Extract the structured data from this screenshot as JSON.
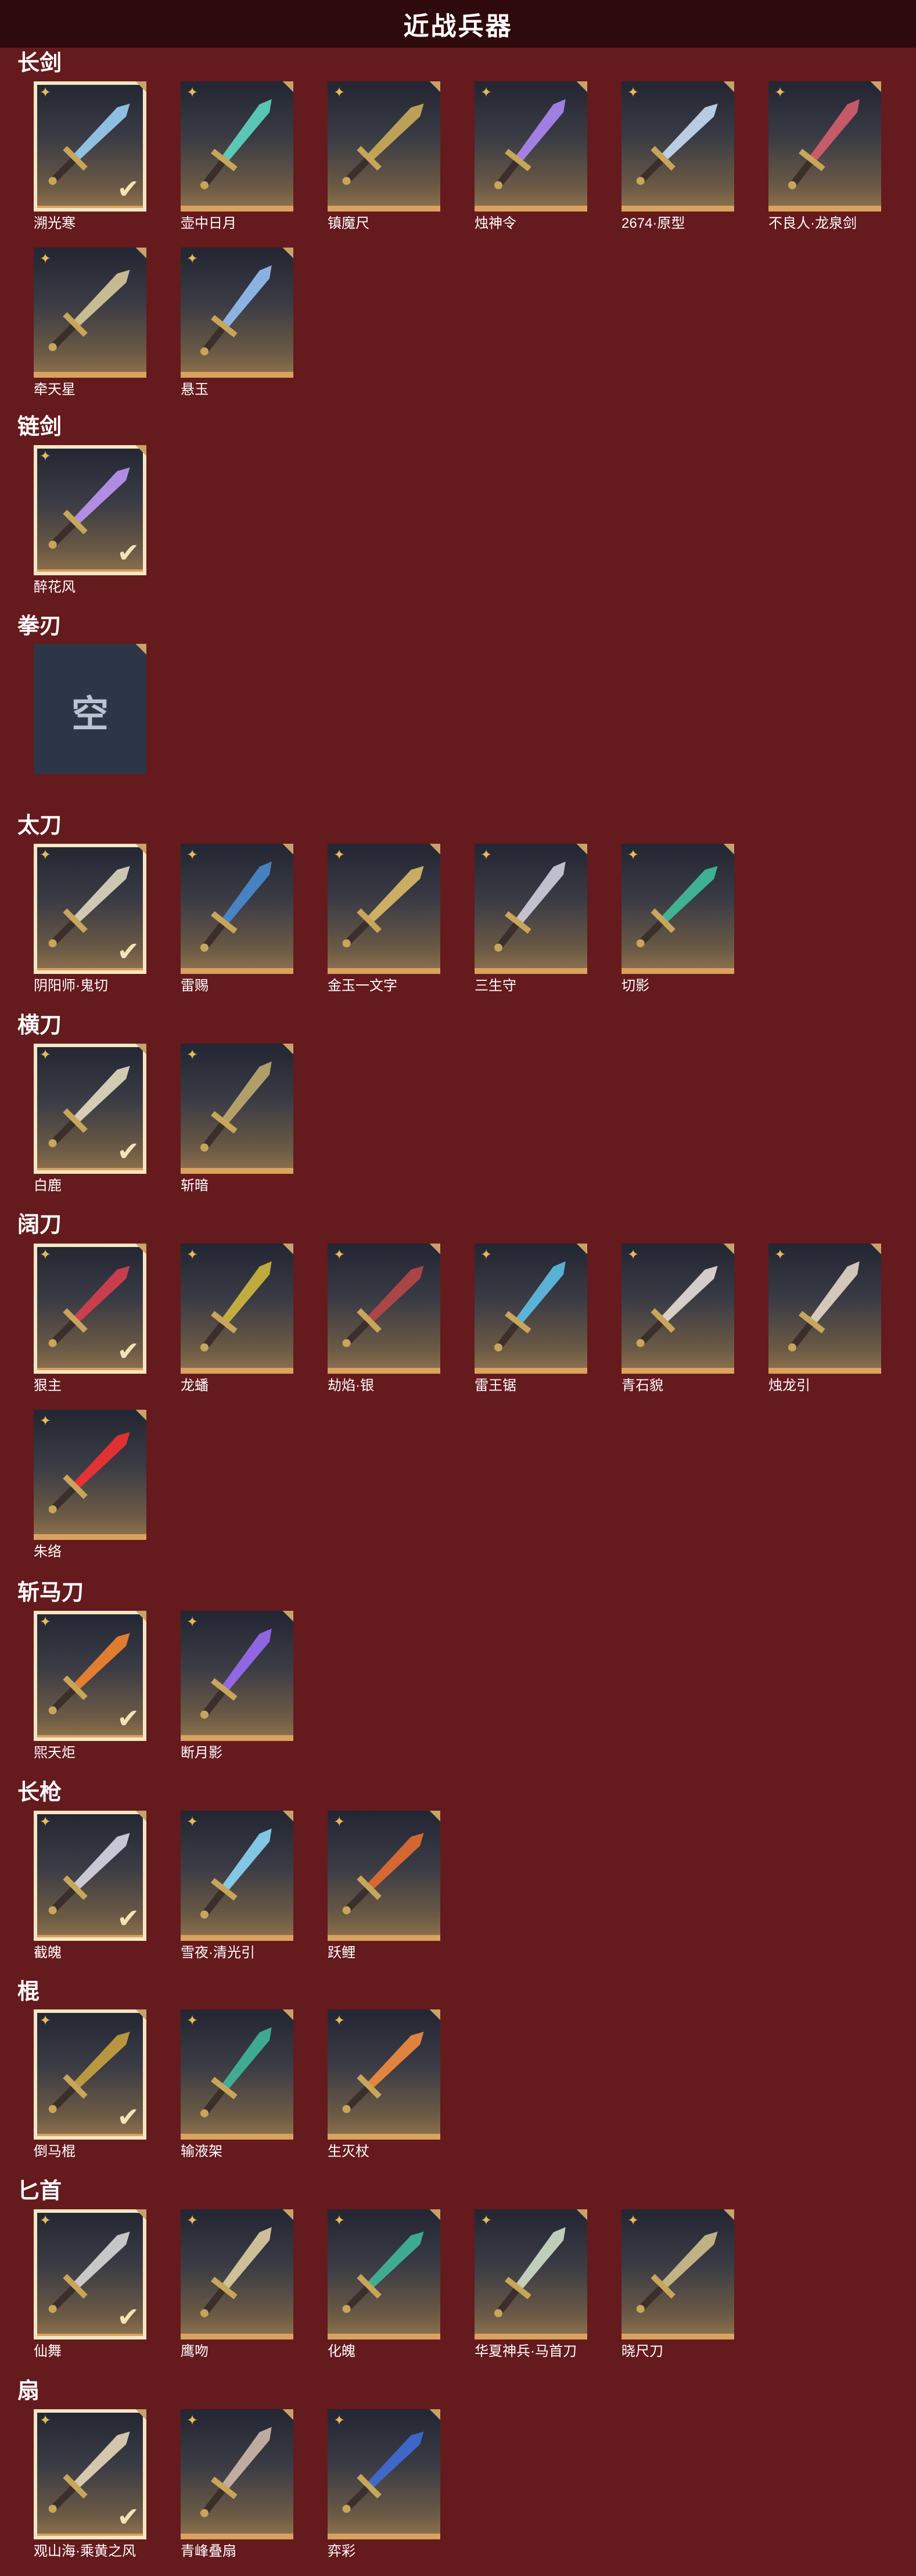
{
  "header": {
    "title": "近战兵器"
  },
  "sections": [
    {
      "id": "changjian",
      "title": "长剑",
      "items": [
        "溯光寒",
        "壶中日月",
        "镇魔尺",
        "烛神令",
        "2674·原型",
        "不良人·龙泉剑",
        "牵天星",
        "悬玉"
      ]
    },
    {
      "id": "lianjian",
      "title": "链剑",
      "items": [
        "醉花风"
      ]
    },
    {
      "id": "quanren",
      "title": "拳刃",
      "empty_label": "空"
    },
    {
      "id": "taidao",
      "title": "太刀",
      "items": [
        "阴阳师·鬼切",
        "雷赐",
        "金玉一文字",
        "三生守",
        "切影"
      ]
    },
    {
      "id": "hengdao",
      "title": "横刀",
      "items": [
        "白鹿",
        "斩暗"
      ]
    },
    {
      "id": "kuodao",
      "title": "阔刀",
      "items": [
        "狠主",
        "龙蟠",
        "劫焰·银",
        "雷王锯",
        "青石貌",
        "烛龙引",
        "朱络"
      ]
    },
    {
      "id": "zhanmadao",
      "title": "斩马刀",
      "items": [
        "煕天炬",
        "断月影"
      ]
    },
    {
      "id": "changqiang",
      "title": "长枪",
      "items": [
        "截魄",
        "雪夜·清光引",
        "跃鲤"
      ]
    },
    {
      "id": "gun",
      "title": "棍",
      "items": [
        "倒马棍",
        "输液架",
        "生灭杖"
      ]
    },
    {
      "id": "bishou",
      "title": "匕首",
      "items": [
        "仙舞",
        "鹰吻",
        "化魄",
        "华夏神兵·马首刀",
        "晓尺刀"
      ]
    },
    {
      "id": "shan",
      "title": "扇",
      "items": [
        "观山海·乘黄之风",
        "青峰叠扇",
        "弈彩"
      ]
    }
  ]
}
